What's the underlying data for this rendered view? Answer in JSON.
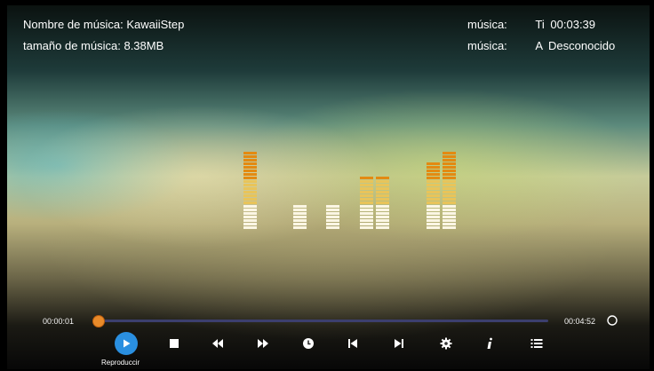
{
  "track": {
    "name_label": "Nombre de música:",
    "name_value": "KawaiiStep",
    "size_label": "tamaño de música:",
    "size_value": "8.38MB",
    "right_label_1": "música:",
    "right_label_1_prefix": "Ti",
    "right_value_1": "00:03:39",
    "right_label_2": "música:",
    "right_label_2_prefix": "A",
    "right_value_2": "Desconocido"
  },
  "playback": {
    "current_time": "00:00:01",
    "total_time": "00:04:52",
    "progress_fraction": 0.0
  },
  "visualizer": {
    "bar_segment_counts": [
      22,
      0,
      7,
      7,
      15,
      15,
      0,
      19,
      22
    ],
    "colors": {
      "white": "#fbf6e4",
      "yellow": "#e8c45a",
      "orange": "#e38a12"
    }
  },
  "controls": {
    "items": [
      {
        "name": "play-icon",
        "label": "Reproduccir"
      },
      {
        "name": "stop-icon"
      },
      {
        "name": "rewind-icon"
      },
      {
        "name": "fast-forward-icon"
      },
      {
        "name": "clock-icon"
      },
      {
        "name": "previous-track-icon"
      },
      {
        "name": "next-track-icon"
      },
      {
        "name": "gear-icon"
      },
      {
        "name": "info-icon"
      },
      {
        "name": "playlist-icon"
      }
    ],
    "repeat_icon": "repeat-circle-icon",
    "accent": "#2a8fe0"
  }
}
